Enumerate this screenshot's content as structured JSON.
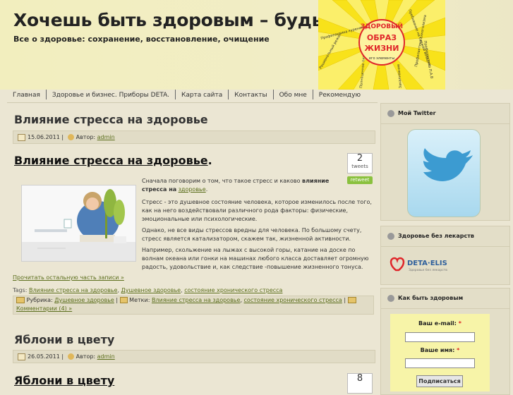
{
  "site": {
    "title": "Хочешь быть здоровым – будь!",
    "description": "Все о здоровье: сохранение, восстановление, очищение"
  },
  "header_image": {
    "center_lines": [
      "ЗДОРОВЫЙ",
      "ОБРАЗ",
      "ЖИЗНИ",
      "его элементы"
    ],
    "rays": [
      "Профилактика курения",
      "Пребывание на свежем воздухе",
      "Профилактика П.А.В",
      "Рациональный режим",
      "Профилактика алкоголизма",
      "Полноценное питание",
      "Закаливание"
    ]
  },
  "nav": {
    "items": [
      "Главная",
      "Здоровье и бизнес. Приборы DETA.",
      "Карта сайта",
      "Контакты",
      "Обо мне",
      "Рекомендую"
    ]
  },
  "post1": {
    "title": "Влияние стресса на здоровье",
    "date": "15.06.2011",
    "author_label": "Автор:",
    "author": "admin",
    "inner_title": "Влияние стресса на здоровье",
    "tweet_count": "2",
    "tweet_label": "tweets",
    "retweet_label": "retweet",
    "intro": "Сначала поговорим о том, что такое стресс и каково",
    "intro_bold": "влияние стресса на",
    "intro_link": "здоровье",
    "para1": "Стресс - это душевное состояние человека, которое изменилось после того, как на него  воздействовали различного рода факторы:  физические, эмоциональные или психологические.",
    "para2": "Однако, не все виды стрессов вредны для человека. По большому счету, стресс является катализатором, скажем так, жизненной активности.",
    "para3": "Например, скольжение на лыжах с высокой горы, катание на доске по волнам океана или гонки на машинах любого класса доставляет огромную радость, удовольствие и, как следствие  -повышение жизненного тонуса.",
    "read_more": "Прочитать остальную часть записи »",
    "tags_label": "Tags:",
    "tags": [
      "Влияние стресса на здоровье",
      "Душевное здоровье",
      "состояние хронического стресса"
    ],
    "rubric_label": "Рубрика:",
    "rubric": "Душевное здоровье",
    "labels_label": "Метки:",
    "labels": [
      "Влияние стресса на здоровье",
      "состояние хронического стресса"
    ],
    "comments": "Комментарии (4) »"
  },
  "post2": {
    "title": "Яблони в цвету",
    "date": "26.05.2011",
    "author_label": "Автор:",
    "author": "admin",
    "inner_title": "Яблони в цвету",
    "tweet_count": "8"
  },
  "sidebar": {
    "twitter_title": "Мой Twitter",
    "health_title": "Здоровье без лекарств",
    "deta_logo": "DETA·ELIS",
    "deta_tagline": "Здоровье без лекарств",
    "how_title": "Как быть здоровым",
    "email_label": "Ваш e-mail:",
    "name_label": "Ваше имя:",
    "required_mark": "*",
    "subscribe_label": "Подписаться"
  },
  "colors": {
    "background": "#ebe6d3",
    "header": "#f2eebe",
    "link": "#5b6e1c",
    "sun_yellow": "#f8e21a",
    "sun_red": "#e0262a",
    "twitter_blue": "#3c9bd1",
    "form_bg": "#f7f4a8"
  }
}
